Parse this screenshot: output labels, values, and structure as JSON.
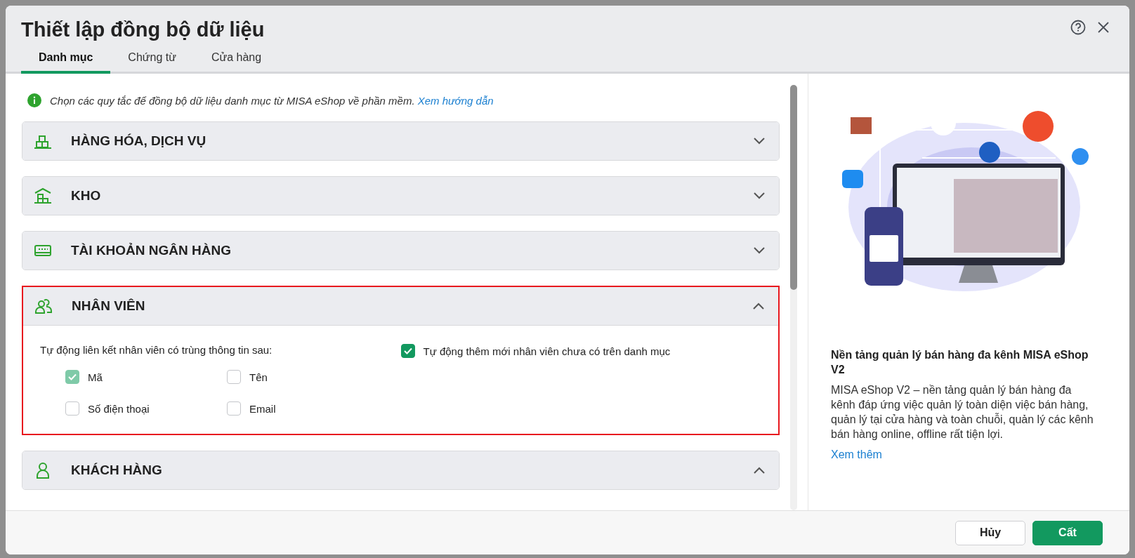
{
  "dialog": {
    "title": "Thiết lập đồng bộ dữ liệu"
  },
  "tabs": [
    {
      "label": "Danh mục",
      "selected": true
    },
    {
      "label": "Chứng từ",
      "selected": false
    },
    {
      "label": "Cửa hàng",
      "selected": false
    }
  ],
  "info": {
    "text": "Chọn các quy tắc để đồng bộ dữ liệu danh mục từ MISA eShop về phần mềm.",
    "link": "Xem hướng dẫn"
  },
  "sections": [
    {
      "kind": "goods",
      "title": "HÀNG HÓA, DỊCH VỤ",
      "expanded": false,
      "highlighted": false
    },
    {
      "kind": "warehouse",
      "title": "KHO",
      "expanded": false,
      "highlighted": false
    },
    {
      "kind": "bank",
      "title": "TÀI KHOẢN NGÂN HÀNG",
      "expanded": false,
      "highlighted": false
    },
    {
      "kind": "employee",
      "title": "NHÂN VIÊN",
      "expanded": true,
      "highlighted": true,
      "match_label": "Tự động liên kết nhân viên có trùng thông tin sau:",
      "match_fields": [
        {
          "label": "Mã",
          "checked": true,
          "disabled": true
        },
        {
          "label": "Tên",
          "checked": false,
          "disabled": false
        },
        {
          "label": "Số điện thoại",
          "checked": false,
          "disabled": false
        },
        {
          "label": "Email",
          "checked": false,
          "disabled": false
        }
      ],
      "auto_add": {
        "label": "Tự động thêm mới nhân viên chưa có trên danh mục",
        "checked": true,
        "disabled": false
      }
    },
    {
      "kind": "customer",
      "title": "KHÁCH HÀNG",
      "expanded": true,
      "highlighted": false
    }
  ],
  "promo": {
    "title": "Nền tảng quản lý bán hàng đa kênh MISA eShop V2",
    "text": "MISA eShop V2 – nền tảng quản lý bán hàng đa kênh đáp ứng việc quản lý toàn diện việc bán hàng, quản lý tại cửa hàng và toàn chuỗi, quản lý các kênh bán hàng online, offline rất tiện lợi.",
    "link": "Xem thêm"
  },
  "buttons": [
    {
      "kind": "secondary",
      "label": "Hủy"
    },
    {
      "kind": "primary",
      "label": "Cất"
    }
  ]
}
